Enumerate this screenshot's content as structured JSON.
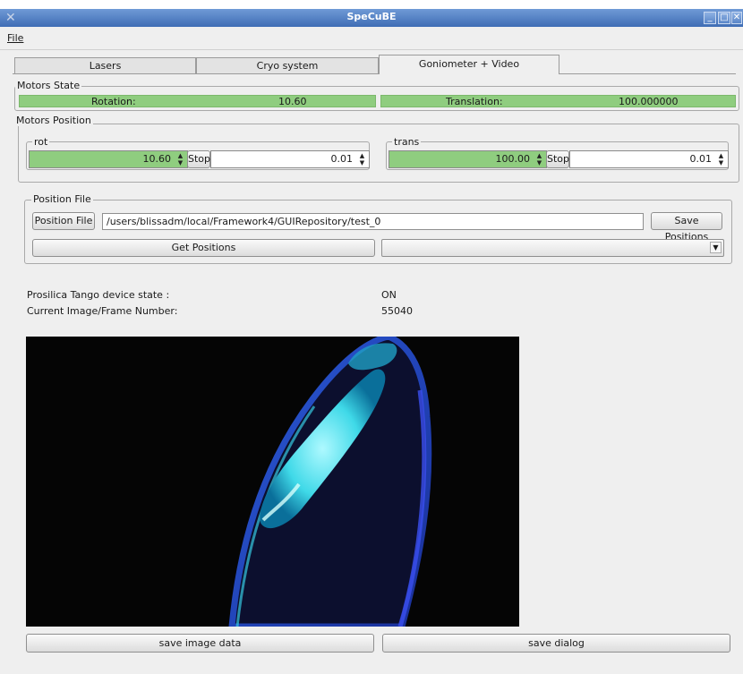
{
  "window": {
    "title": "SpeCuBE",
    "menu": {
      "file": "File"
    }
  },
  "tabs": [
    "Lasers",
    "Cryo system",
    "Goniometer + Video"
  ],
  "motors_state": {
    "title": "Motors State",
    "rotation_label": "Rotation:",
    "rotation_value": "10.60",
    "translation_label": "Translation:",
    "translation_value": "100.000000"
  },
  "motors_position": {
    "title": "Motors Position",
    "rot": {
      "title": "rot",
      "value": "10.60",
      "stop": "Stop",
      "step": "0.01"
    },
    "trans": {
      "title": "trans",
      "value": "100.00",
      "stop": "Stop",
      "step": "0.01"
    }
  },
  "position_file": {
    "title": "Position File",
    "button": "Position File",
    "path": "/users/blissadm/local/Framework4/GUIRepository/test_0",
    "save_button": "Save Positions",
    "get_button": "Get Positions",
    "combo_value": ""
  },
  "device": {
    "state_label": "Prosilica Tango device state  :",
    "state_value": "ON",
    "frame_label": "Current Image/Frame Number:",
    "frame_value": "55040"
  },
  "bottom_buttons": {
    "save_image": "save image data",
    "save_dialog": "save dialog"
  },
  "colors": {
    "titlebar": "#4f7dc2",
    "motor_ok": "#8fcd7f",
    "background": "#efefef"
  },
  "icons": [
    "app-x-icon",
    "minimize-icon",
    "maximize-icon",
    "close-icon",
    "spin-arrows-icon",
    "chevron-down-icon"
  ]
}
